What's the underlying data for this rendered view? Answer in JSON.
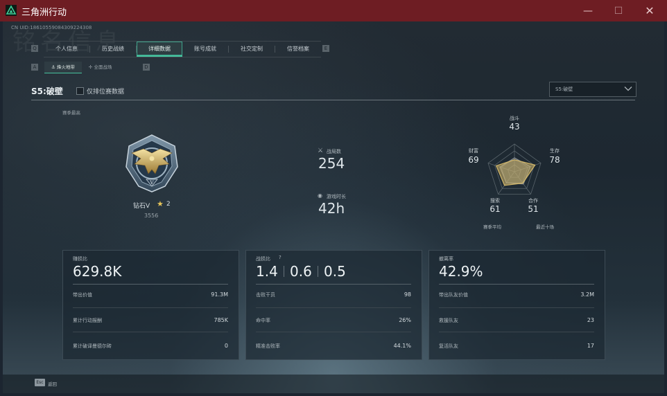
{
  "window": {
    "title": "三角洲行动",
    "minimize_glyph": "—",
    "maximize_glyph": "☐",
    "close_glyph": "✕"
  },
  "header": {
    "watermark": "铭名信息",
    "uid": "CN UID:18610559084309224308"
  },
  "nav": {
    "left_key": "Q",
    "right_key": "E",
    "tabs": [
      "个人信息",
      "历史战绩",
      "详细数据",
      "账号成就",
      "社交定制",
      "信誉档案"
    ],
    "active_tab": "详细数据",
    "sub_left_key": "A",
    "sub_right_key": "D",
    "subtabs": [
      "烽火地带",
      "全面战场"
    ],
    "active_subtab": "烽火地带"
  },
  "filter": {
    "season_title": "S5:破壁",
    "ranked_only_label": "仅排位赛数据",
    "ranked_only_checked": false,
    "season_dropdown": "S5:破壁"
  },
  "rank": {
    "season_high_label": "赛季最高",
    "name": "钻石V",
    "stars": "2",
    "score": "3556"
  },
  "summary": {
    "matches_label": "战局数",
    "matches": "254",
    "playtime_label": "游戏时长",
    "playtime": "42h"
  },
  "radar": {
    "combat_label": "战斗",
    "combat": "43",
    "survival_label": "生存",
    "survival": "78",
    "coop_label": "合作",
    "coop": "51",
    "search_label": "搜索",
    "search": "61",
    "wealth_label": "财富",
    "wealth": "69",
    "legend_avg": "赛季平均",
    "legend_recent": "最近十场",
    "values_recent": [
      43,
      78,
      51,
      61,
      69
    ],
    "values_avg": [
      50,
      60,
      55,
      50,
      55
    ],
    "max": 100,
    "recent_color": "#d4b86a",
    "avg_color": "#8c9196"
  },
  "cards": {
    "loot": {
      "title": "赚损比",
      "big": "629.8K",
      "rows": [
        {
          "label": "带出价值",
          "value": "91.3M"
        },
        {
          "label": "累计行动报酬",
          "value": "785K"
        },
        {
          "label": "累计破译曼德尔砖",
          "value": "0"
        }
      ]
    },
    "combat": {
      "title": "战损比",
      "help_glyph": "?",
      "ratios": [
        "1.4",
        "0.6",
        "0.5"
      ],
      "rows": [
        {
          "label": "击败干员",
          "value": "98"
        },
        {
          "label": "命中率",
          "value": "26%"
        },
        {
          "label": "精准击败率",
          "value": "44.1%"
        }
      ]
    },
    "extract": {
      "title": "撤离率",
      "big": "42.9%",
      "rows": [
        {
          "label": "带出队友价值",
          "value": "3.2M"
        },
        {
          "label": "救援队友",
          "value": "23"
        },
        {
          "label": "复活队友",
          "value": "17"
        }
      ]
    }
  },
  "footer": {
    "back_key": "Esc",
    "back_label": "返回"
  },
  "colors": {
    "titlebar": "#6e1d23",
    "accent_green": "#46c39e",
    "radar_gold": "#d4b86a"
  }
}
